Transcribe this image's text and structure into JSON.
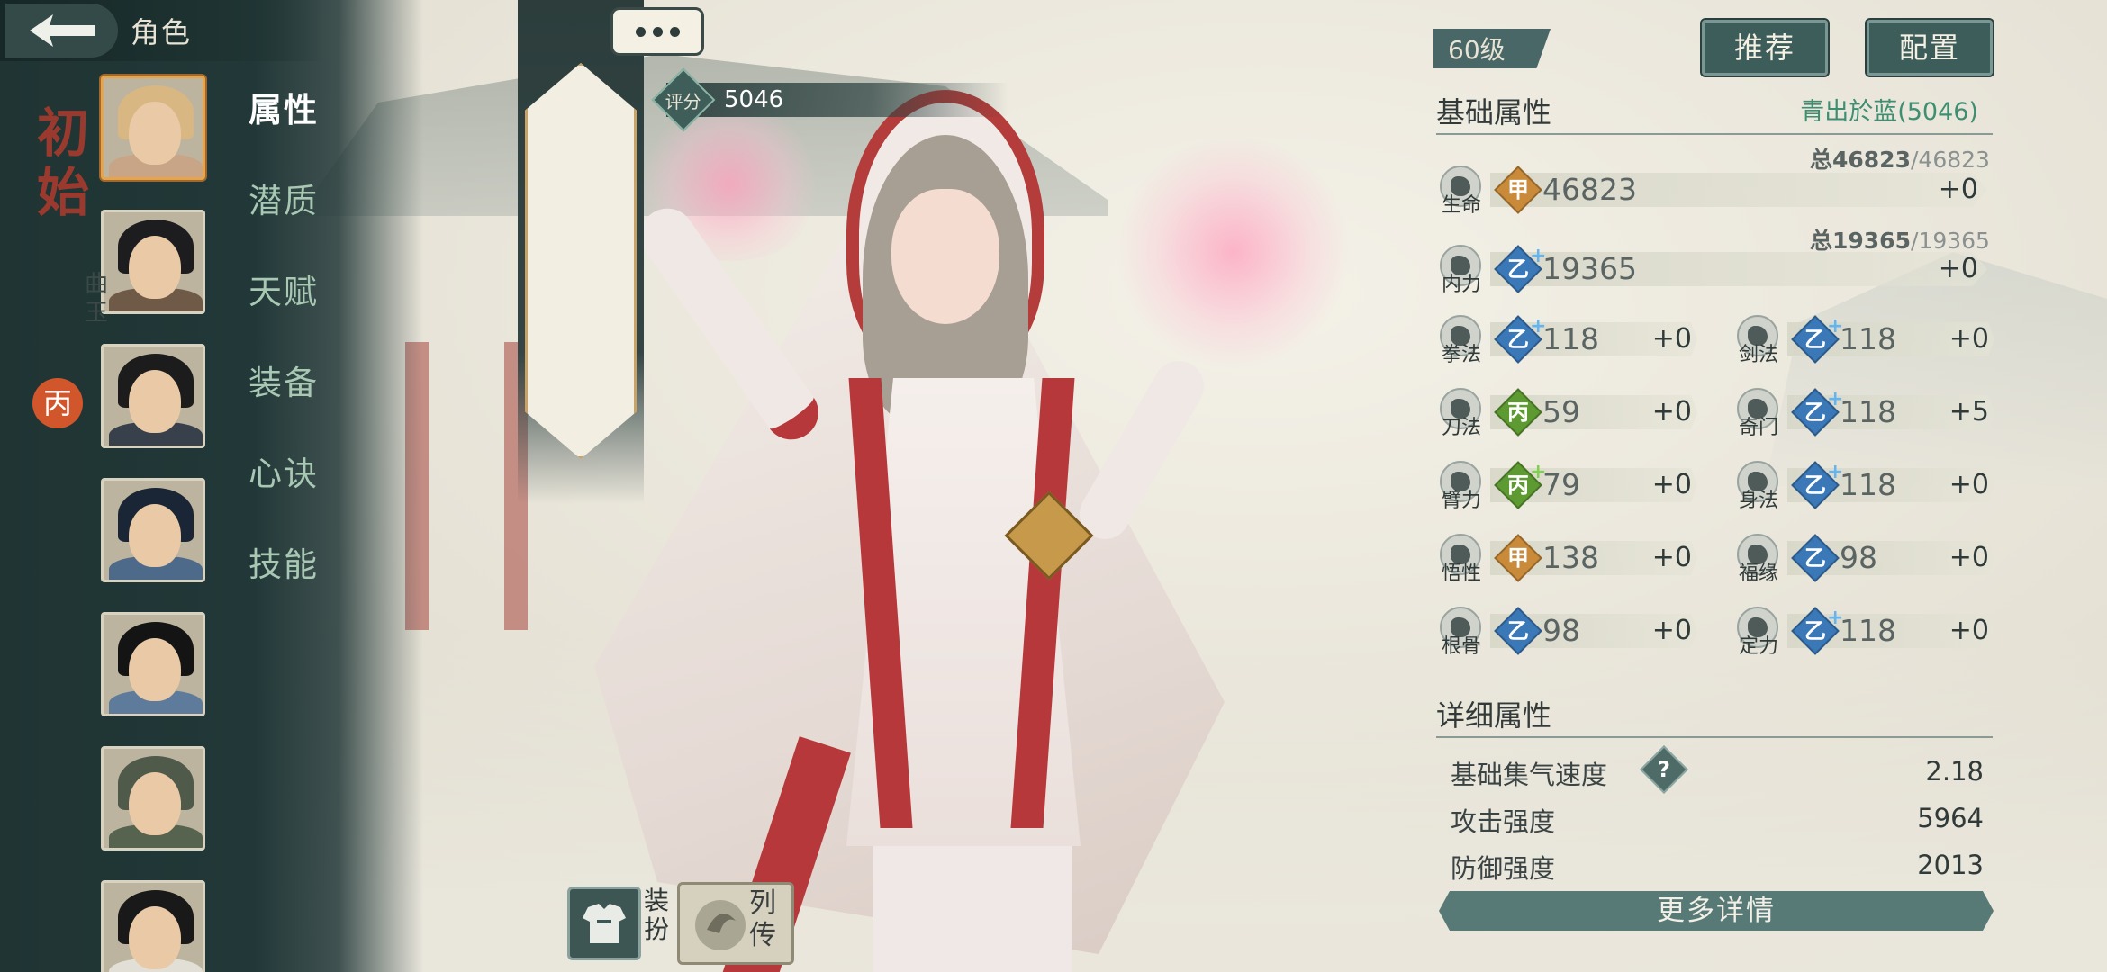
{
  "topbar": {
    "title": "角色"
  },
  "menu": {
    "items": [
      {
        "label": "属性",
        "active": true
      },
      {
        "label": "潜质",
        "active": false
      },
      {
        "label": "天赋",
        "active": false
      },
      {
        "label": "装备",
        "active": false
      },
      {
        "label": "心诀",
        "active": false
      },
      {
        "label": "技能",
        "active": false
      }
    ]
  },
  "portraits": [
    {
      "name": "portrait-1",
      "selected": true,
      "hair": "#d8b783",
      "body": "#c7a586"
    },
    {
      "name": "portrait-2",
      "selected": false,
      "hair": "#1d1d1f",
      "body": "#6e5a47"
    },
    {
      "name": "portrait-3",
      "selected": false,
      "hair": "#1c1c1c",
      "body": "#37404b"
    },
    {
      "name": "portrait-4",
      "selected": false,
      "hair": "#1a2535",
      "body": "#4d6a8b"
    },
    {
      "name": "portrait-5",
      "selected": false,
      "hair": "#141414",
      "body": "#5f7b9c"
    },
    {
      "name": "portrait-6",
      "selected": false,
      "hair": "#4f5a4b",
      "body": "#56634f"
    },
    {
      "name": "portrait-7",
      "selected": false,
      "hair": "#191919",
      "body": "#e2e0d6"
    }
  ],
  "character": {
    "name": "初始",
    "subtitle": "曲玉",
    "rank": "丙",
    "score_label": "评分",
    "score": "5046"
  },
  "header": {
    "level": "60级",
    "recommend_btn": "推荐",
    "config_btn": "配置"
  },
  "basic": {
    "title": "基础属性",
    "tag": "青出於蓝(5046)",
    "hp": {
      "label": "生命",
      "grade": "甲",
      "grade_color": "jia",
      "value": "46823",
      "plus": "+0",
      "total_label": "总46823",
      "total_max": "/46823"
    },
    "mp": {
      "label": "内力",
      "grade": "乙",
      "grade_color": "yi",
      "value": "19365",
      "plus": "+0",
      "total_label": "总19365",
      "total_max": "/19365",
      "upgrade": "+"
    },
    "stats": [
      {
        "label": "拳法",
        "grade": "乙",
        "grade_color": "yi",
        "upgrade": "+",
        "value": "118",
        "plus": "+0"
      },
      {
        "label": "剑法",
        "grade": "乙",
        "grade_color": "yi",
        "upgrade": "+",
        "value": "118",
        "plus": "+0"
      },
      {
        "label": "刀法",
        "grade": "丙",
        "grade_color": "bing",
        "upgrade": "",
        "value": "59",
        "plus": "+0"
      },
      {
        "label": "奇门",
        "grade": "乙",
        "grade_color": "yi",
        "upgrade": "+",
        "value": "118",
        "plus": "+5"
      },
      {
        "label": "臂力",
        "grade": "丙",
        "grade_color": "bing",
        "upgrade": "+",
        "value": "79",
        "plus": "+0"
      },
      {
        "label": "身法",
        "grade": "乙",
        "grade_color": "yi",
        "upgrade": "+",
        "value": "118",
        "plus": "+0"
      },
      {
        "label": "悟性",
        "grade": "甲",
        "grade_color": "jia",
        "upgrade": "",
        "value": "138",
        "plus": "+0"
      },
      {
        "label": "福缘",
        "grade": "乙",
        "grade_color": "yi",
        "upgrade": "",
        "value": "98",
        "plus": "+0"
      },
      {
        "label": "根骨",
        "grade": "乙",
        "grade_color": "yi",
        "upgrade": "",
        "value": "98",
        "plus": "+0"
      },
      {
        "label": "定力",
        "grade": "乙",
        "grade_color": "yi",
        "upgrade": "+",
        "value": "118",
        "plus": "+0"
      }
    ]
  },
  "detail": {
    "title": "详细属性",
    "rows": [
      {
        "label": "基础集气速度",
        "value": "2.18",
        "help": "?"
      },
      {
        "label": "攻击强度",
        "value": "5964"
      },
      {
        "label": "防御强度",
        "value": "2013"
      }
    ],
    "more_btn": "更多详情"
  },
  "bottom": {
    "dress_label": "装扮",
    "bio_label": "列传"
  }
}
